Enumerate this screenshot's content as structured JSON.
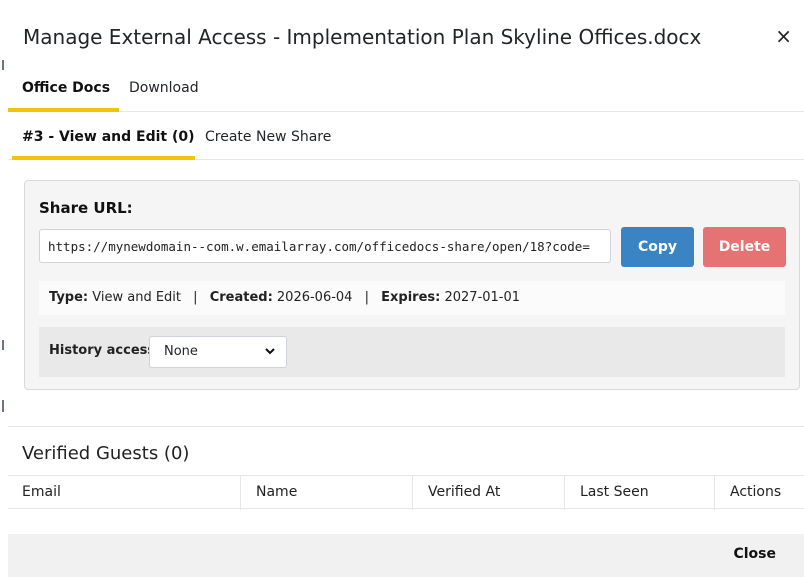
{
  "modal": {
    "title": "Manage External Access - Implementation Plan Skyline Offices.docx",
    "close_symbol": "×"
  },
  "tabs_main": [
    {
      "label": "Office Docs",
      "active": true
    },
    {
      "label": "Download",
      "active": false
    }
  ],
  "tabs_sub": [
    {
      "label": "#3 - View and Edit (0)",
      "active": true
    },
    {
      "label": "Create New Share",
      "active": false
    }
  ],
  "share": {
    "label": "Share URL:",
    "url": "https://mynewdomain--com.w.emailarray.com/officedocs-share/open/18?code=",
    "copy_label": "Copy",
    "delete_label": "Delete",
    "meta": {
      "type_label": "Type:",
      "type_value": "View and Edit",
      "created_label": "Created:",
      "created_value": "2026-06-04",
      "expires_label": "Expires:",
      "expires_value": "2027-01-01",
      "separator": "|"
    },
    "history": {
      "label": "History access:",
      "selected": "None"
    }
  },
  "guests": {
    "title": "Verified Guests (0)",
    "columns": [
      "Email",
      "Name",
      "Verified At",
      "Last Seen",
      "Actions"
    ]
  },
  "footer": {
    "close_label": "Close"
  },
  "colors": {
    "accent_tab": "#f1c40f",
    "copy_button": "#3a84c4",
    "delete_button": "#e57373"
  }
}
